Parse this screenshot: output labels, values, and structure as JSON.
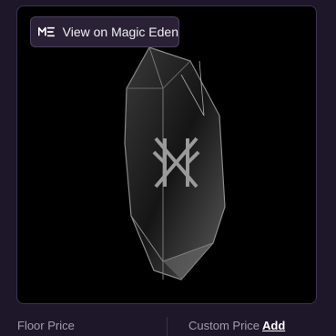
{
  "marketplace_button": {
    "label": "View on Magic Eden",
    "icon": "magic-eden-logo-icon"
  },
  "nft": {
    "icon": "crystal-rune-icon"
  },
  "stats": {
    "floor_price_label": "Floor Price",
    "custom_price_label": "Custom Price",
    "add_label": "Add"
  },
  "colors": {
    "background": "#1d1729",
    "frame": "#000000",
    "button": "#2a2136"
  }
}
